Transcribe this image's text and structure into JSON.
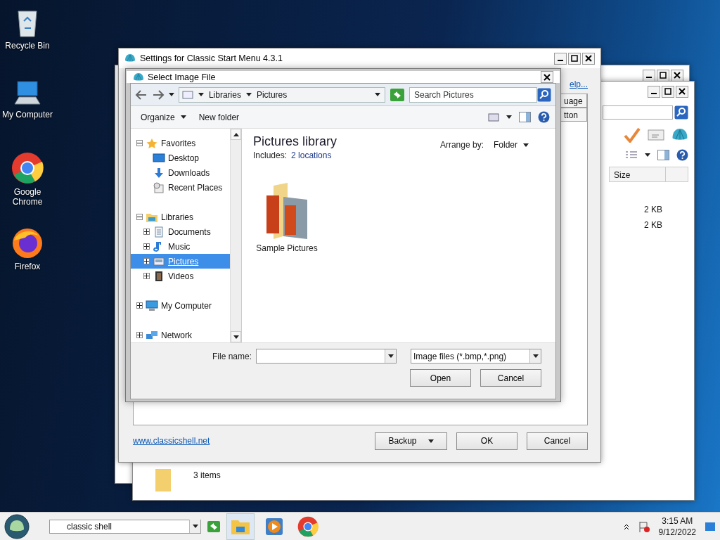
{
  "desktop_icons": [
    {
      "label": "Recycle Bin",
      "kind": "bin"
    },
    {
      "label": "My Computer",
      "kind": "computer"
    },
    {
      "label": "Google Chrome",
      "kind": "chrome"
    },
    {
      "label": "Firefox",
      "kind": "firefox"
    }
  ],
  "explorer_window": {
    "size_column": "Size",
    "sizes": [
      "2 KB",
      "2 KB"
    ],
    "status": "3 items"
  },
  "settings_window": {
    "title": "Settings for Classic Start Menu 4.3.1",
    "help_link": "elp...",
    "tabs": [
      "uage",
      "tton"
    ],
    "website": "www.classicshell.net",
    "backup": "Backup",
    "ok": "OK",
    "cancel": "Cancel"
  },
  "dialog": {
    "title": "Select Image File",
    "breadcrumb": [
      "Libraries",
      "Pictures"
    ],
    "search_placeholder": "Search Pictures",
    "organize": "Organize",
    "new_folder": "New folder",
    "nav": [
      {
        "label": "Favorites",
        "kind": "star",
        "expanded": true,
        "children": [
          {
            "label": "Desktop",
            "kind": "desktop"
          },
          {
            "label": "Downloads",
            "kind": "download"
          },
          {
            "label": "Recent Places",
            "kind": "recent"
          }
        ]
      },
      {
        "label": "Libraries",
        "kind": "library",
        "expanded": true,
        "children": [
          {
            "label": "Documents",
            "kind": "document",
            "expanded": false,
            "selected": false
          },
          {
            "label": "Music",
            "kind": "music",
            "expanded": false,
            "selected": false
          },
          {
            "label": "Pictures",
            "kind": "picture",
            "expanded": false,
            "selected": true
          },
          {
            "label": "Videos",
            "kind": "video",
            "expanded": false,
            "selected": false
          }
        ]
      },
      {
        "label": "My Computer",
        "kind": "computer",
        "expanded": false
      },
      {
        "label": "Network",
        "kind": "network",
        "expanded": false
      }
    ],
    "library_title": "Pictures library",
    "includes_label": "Includes:",
    "includes_link": "2 locations",
    "arrange_label": "Arrange by:",
    "arrange_value": "Folder",
    "items": [
      {
        "label": "Sample Pictures"
      }
    ],
    "filename_label": "File name:",
    "filter": "Image files (*.bmp,*.png)",
    "open": "Open",
    "cancel": "Cancel"
  },
  "taskbar": {
    "search_value": "classic shell",
    "apps": [
      {
        "kind": "explorer",
        "selected": true
      },
      {
        "kind": "media",
        "selected": false
      },
      {
        "kind": "chrome",
        "selected": false
      }
    ],
    "time": "3:15 AM",
    "date": "9/12/2022"
  }
}
